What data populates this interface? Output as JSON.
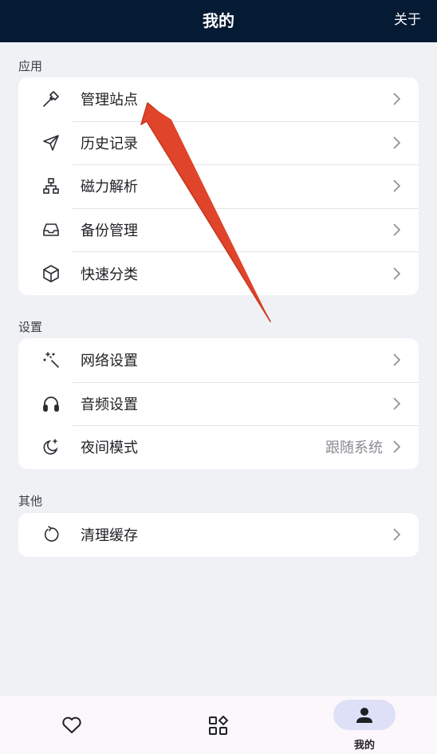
{
  "header": {
    "title": "我的",
    "about": "关于"
  },
  "sections": {
    "app": {
      "label": "应用",
      "items": [
        {
          "label": "管理站点",
          "icon": "hammer-icon"
        },
        {
          "label": "历史记录",
          "icon": "send-icon"
        },
        {
          "label": "磁力解析",
          "icon": "sitemap-icon"
        },
        {
          "label": "备份管理",
          "icon": "inbox-icon"
        },
        {
          "label": "快速分类",
          "icon": "cube-icon"
        }
      ]
    },
    "settings": {
      "label": "设置",
      "items": [
        {
          "label": "网络设置",
          "icon": "magic-wand-icon"
        },
        {
          "label": "音频设置",
          "icon": "headphones-icon"
        },
        {
          "label": "夜间模式",
          "icon": "moon-stars-icon",
          "value": "跟随系统"
        }
      ]
    },
    "other": {
      "label": "其他",
      "items": [
        {
          "label": "清理缓存",
          "icon": "refresh-icon"
        }
      ]
    }
  },
  "bottom_nav": {
    "items": [
      {
        "icon": "heart-icon"
      },
      {
        "icon": "apps-icon"
      },
      {
        "icon": "person-icon",
        "label": "我的",
        "active": true
      }
    ]
  },
  "colors": {
    "header_bg": "#051a33",
    "page_bg": "#f0f1f5",
    "active_pill": "#dde0f7",
    "annotation_arrow": "#e0442a"
  }
}
